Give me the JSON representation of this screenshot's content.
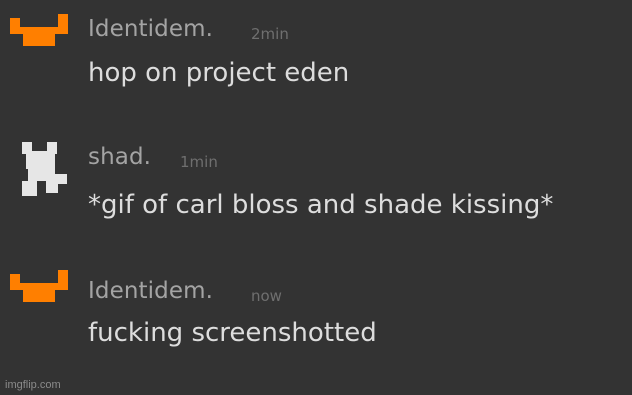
{
  "messages": [
    {
      "username": "Identidem.",
      "timestamp": "2min",
      "text": "hop on project eden",
      "avatar_icon": "orange-pixel-crown-icon",
      "avatar_color": "#ff7f00"
    },
    {
      "username": "shad.",
      "timestamp": "1min",
      "text": "*gif of carl bloss and shade kissing*",
      "avatar_icon": "white-pixel-figure-icon",
      "avatar_color": "#e6e6e6"
    },
    {
      "username": "Identidem.",
      "timestamp": "now",
      "text": "fucking screenshotted",
      "avatar_icon": "orange-pixel-crown-icon",
      "avatar_color": "#ff7f00"
    }
  ],
  "watermark": "imgflip.com",
  "colors": {
    "background": "#333333",
    "username": "#a4a4a4",
    "timestamp": "#6f6f6f",
    "message_text": "#dddddd"
  }
}
